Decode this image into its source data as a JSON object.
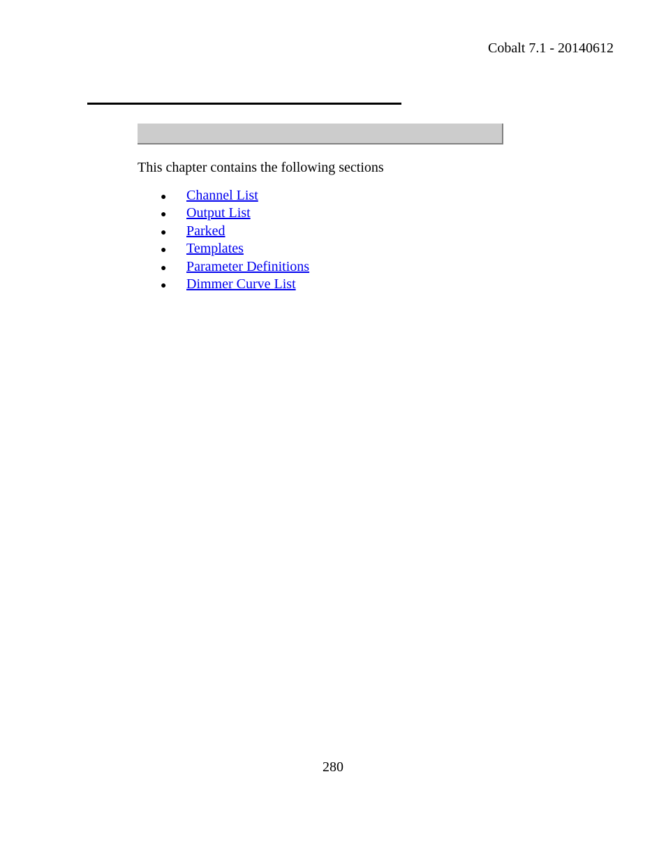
{
  "header": {
    "version_text": "Cobalt 7.1 - 20140612"
  },
  "content": {
    "intro": "This chapter contains the following sections",
    "links": [
      {
        "label": "Channel List"
      },
      {
        "label": "Output List"
      },
      {
        "label": "Parked"
      },
      {
        "label": "Templates"
      },
      {
        "label": "Parameter Definitions"
      },
      {
        "label": "Dimmer Curve List"
      }
    ]
  },
  "footer": {
    "page_number": "280"
  }
}
